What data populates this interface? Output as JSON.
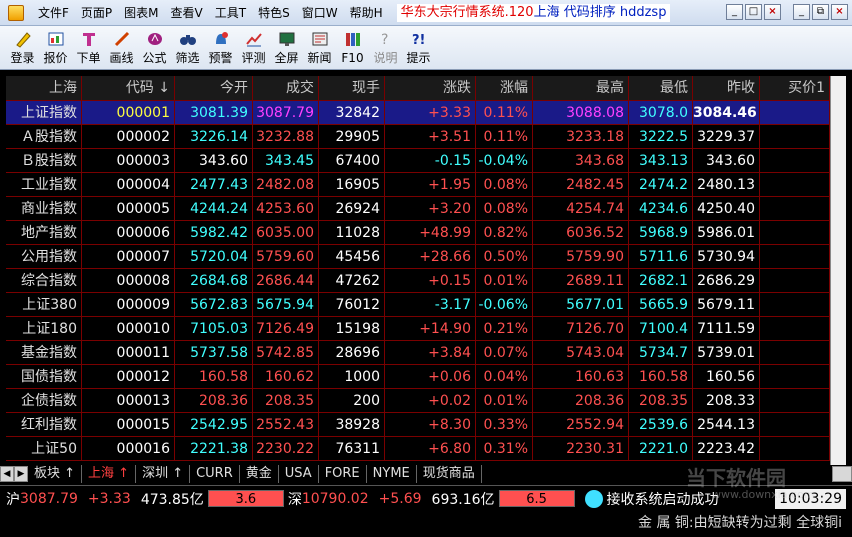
{
  "menu": [
    "文件F",
    "页面P",
    "图表M",
    "查看V",
    "工具T",
    "特色S",
    "窗口W",
    "帮助H"
  ],
  "window_title": {
    "prefix": "华东大宗行情系统.120",
    "market": "上海",
    "suffix": "代码排序 hddzsp"
  },
  "window_buttons": {
    "min": "_",
    "restore": "□",
    "close": "×",
    "min2": "_",
    "restore2": "⧉",
    "close2": "×"
  },
  "toolbar": [
    {
      "label": "登录",
      "icon": "pen-login-icon"
    },
    {
      "label": "报价",
      "icon": "quote-icon"
    },
    {
      "label": "下单",
      "icon": "order-icon"
    },
    {
      "label": "画线",
      "icon": "draw-line-icon"
    },
    {
      "label": "公式",
      "icon": "formula-icon"
    },
    {
      "label": "筛选",
      "icon": "binoculars-icon"
    },
    {
      "label": "预警",
      "icon": "alarm-icon"
    },
    {
      "label": "评测",
      "icon": "evaluate-icon"
    },
    {
      "label": "全屏",
      "icon": "monitor-icon"
    },
    {
      "label": "新闻",
      "icon": "news-icon"
    },
    {
      "label": "F10",
      "icon": "books-icon"
    },
    {
      "label": "说明",
      "icon": "help-disabled-icon",
      "disabled": true
    },
    {
      "label": "提示",
      "icon": "tip-icon"
    }
  ],
  "table": {
    "headers": [
      "上海",
      "代码 ↓",
      "今开",
      "成交",
      "现手",
      "涨跌",
      "涨幅",
      "最高",
      "最低",
      "昨收",
      "买价1"
    ],
    "rows": [
      {
        "name": "上证指数",
        "code": "000001",
        "open": "3081.39",
        "close": "3087.79",
        "vol": "32842",
        "chg": "+3.33",
        "pct": "0.11%",
        "high": "3088.08",
        "low": "3078.0",
        "prev": "3084.46"
      },
      {
        "name": "Ａ股指数",
        "code": "000002",
        "open": "3226.14",
        "close": "3232.88",
        "vol": "29905",
        "chg": "+3.51",
        "pct": "0.11%",
        "high": "3233.18",
        "low": "3222.5",
        "prev": "3229.37"
      },
      {
        "name": "Ｂ股指数",
        "code": "000003",
        "open": "343.60",
        "close": "343.45",
        "vol": "67400",
        "chg": "-0.15",
        "pct": "-0.04%",
        "high": "343.68",
        "low": "343.13",
        "prev": "343.60"
      },
      {
        "name": "工业指数",
        "code": "000004",
        "open": "2477.43",
        "close": "2482.08",
        "vol": "16905",
        "chg": "+1.95",
        "pct": "0.08%",
        "high": "2482.45",
        "low": "2474.2",
        "prev": "2480.13"
      },
      {
        "name": "商业指数",
        "code": "000005",
        "open": "4244.24",
        "close": "4253.60",
        "vol": "26924",
        "chg": "+3.20",
        "pct": "0.08%",
        "high": "4254.74",
        "low": "4234.6",
        "prev": "4250.40"
      },
      {
        "name": "地产指数",
        "code": "000006",
        "open": "5982.42",
        "close": "6035.00",
        "vol": "11028",
        "chg": "+48.99",
        "pct": "0.82%",
        "high": "6036.52",
        "low": "5968.9",
        "prev": "5986.01"
      },
      {
        "name": "公用指数",
        "code": "000007",
        "open": "5720.04",
        "close": "5759.60",
        "vol": "45456",
        "chg": "+28.66",
        "pct": "0.50%",
        "high": "5759.90",
        "low": "5711.6",
        "prev": "5730.94"
      },
      {
        "name": "综合指数",
        "code": "000008",
        "open": "2684.68",
        "close": "2686.44",
        "vol": "47262",
        "chg": "+0.15",
        "pct": "0.01%",
        "high": "2689.11",
        "low": "2682.1",
        "prev": "2686.29"
      },
      {
        "name": "上证380",
        "code": "000009",
        "open": "5672.83",
        "close": "5675.94",
        "vol": "76012",
        "chg": "-3.17",
        "pct": "-0.06%",
        "high": "5677.01",
        "low": "5665.9",
        "prev": "5679.11"
      },
      {
        "name": "上证180",
        "code": "000010",
        "open": "7105.03",
        "close": "7126.49",
        "vol": "15198",
        "chg": "+14.90",
        "pct": "0.21%",
        "high": "7126.70",
        "low": "7100.4",
        "prev": "7111.59"
      },
      {
        "name": "基金指数",
        "code": "000011",
        "open": "5737.58",
        "close": "5742.85",
        "vol": "28696",
        "chg": "+3.84",
        "pct": "0.07%",
        "high": "5743.04",
        "low": "5734.7",
        "prev": "5739.01"
      },
      {
        "name": "国债指数",
        "code": "000012",
        "open": "160.58",
        "close": "160.62",
        "vol": "1000",
        "chg": "+0.06",
        "pct": "0.04%",
        "high": "160.63",
        "low": "160.58",
        "prev": "160.56"
      },
      {
        "name": "企债指数",
        "code": "000013",
        "open": "208.36",
        "close": "208.35",
        "vol": "200",
        "chg": "+0.02",
        "pct": "0.01%",
        "high": "208.36",
        "low": "208.35",
        "prev": "208.33"
      },
      {
        "name": "红利指数",
        "code": "000015",
        "open": "2542.95",
        "close": "2552.43",
        "vol": "38928",
        "chg": "+8.30",
        "pct": "0.33%",
        "high": "2552.94",
        "low": "2539.6",
        "prev": "2544.13"
      },
      {
        "name": "上证50",
        "code": "000016",
        "open": "2221.38",
        "close": "2230.22",
        "vol": "76311",
        "chg": "+6.80",
        "pct": "0.31%",
        "high": "2230.31",
        "low": "2221.0",
        "prev": "2223.42"
      }
    ]
  },
  "tabs": [
    {
      "label": "板块 ↑",
      "active": false
    },
    {
      "label": "上海 ↑",
      "active": true
    },
    {
      "label": "深圳 ↑",
      "active": false
    },
    {
      "label": "CURR",
      "active": false
    },
    {
      "label": "黄金",
      "active": false
    },
    {
      "label": "USA",
      "active": false
    },
    {
      "label": "FORE",
      "active": false
    },
    {
      "label": "NYME",
      "active": false
    },
    {
      "label": "现货商品",
      "active": false
    }
  ],
  "status": {
    "sh_label": "沪",
    "sh_index": "3087.79",
    "sh_chg": "+3.33",
    "sh_amount": "473.85亿",
    "sh_bar": "3.6",
    "sz_label": "深",
    "sz_index": "10790.02",
    "sz_chg": "+5.69",
    "sz_amount": "693.16亿",
    "sz_bar": "6.5",
    "message": "接收系统启动成功",
    "time": "10:03:29"
  },
  "news_ticker": "金 属 铜:由短缺转为过剩 全球铜i",
  "watermark": {
    "text": "当下软件园",
    "url": "www.downxia.com"
  },
  "colors": {
    "up": "#ff5050",
    "down": "#40ffff",
    "grid_line": "#7a0000",
    "selected_row": "#1a1a88"
  }
}
